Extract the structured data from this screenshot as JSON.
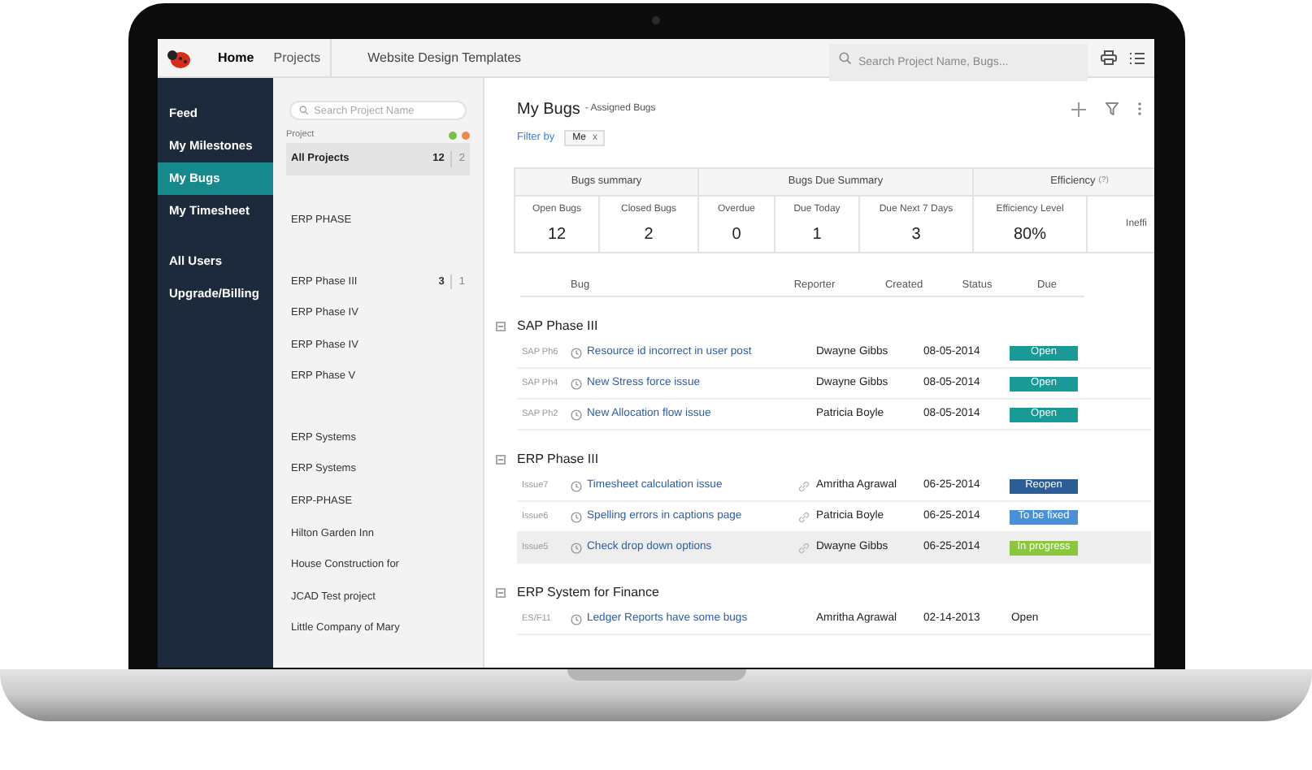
{
  "topbar": {
    "tabs": [
      {
        "label": "Home",
        "selected": true
      },
      {
        "label": "Projects",
        "selected": false
      }
    ],
    "title": "Website Design Templates",
    "search": {
      "placeholder": "Search Project Name, Bugs..."
    }
  },
  "nav": {
    "items": [
      {
        "label": "Feed",
        "selected": false
      },
      {
        "label": "My Milestones",
        "selected": false
      },
      {
        "label": "My Bugs",
        "selected": true
      },
      {
        "label": "My Timesheet",
        "selected": false
      }
    ],
    "secondary": [
      {
        "label": "All Users",
        "selected": false
      },
      {
        "label": "Upgrade/Billing",
        "selected": false
      }
    ]
  },
  "projects": {
    "search": {
      "placeholder": "Search Project Name"
    },
    "header": "Project",
    "legend": [
      {
        "color": "#7ac143"
      },
      {
        "color": "#f08a4b"
      }
    ],
    "all": {
      "label": "All Projects",
      "open": "12",
      "closed": "2",
      "selected": true
    },
    "groups": [
      [
        {
          "label": "ERP PHASE"
        }
      ],
      [
        {
          "label": "ERP Phase III",
          "open": "3",
          "closed": "1"
        },
        {
          "label": "ERP Phase IV"
        },
        {
          "label": "ERP Phase IV"
        },
        {
          "label": "ERP Phase V"
        }
      ],
      [
        {
          "label": "ERP Systems"
        },
        {
          "label": "ERP Systems"
        },
        {
          "label": "ERP-PHASE"
        },
        {
          "label": "Hilton Garden Inn"
        },
        {
          "label": "House Construction for"
        },
        {
          "label": "JCAD Test project"
        },
        {
          "label": "Little Company of Mary"
        }
      ]
    ]
  },
  "main": {
    "title": "My Bugs",
    "subtitle": "- Assigned Bugs",
    "filter": {
      "label": "Filter by",
      "chip": "Me",
      "remove": "x"
    },
    "summary": [
      {
        "title": "Bugs summary",
        "cells": [
          {
            "label": "Open Bugs",
            "value": "12"
          },
          {
            "label": "Closed Bugs",
            "value": "2"
          }
        ]
      },
      {
        "title": "Bugs Due Summary",
        "cells": [
          {
            "label": "Overdue",
            "value": "0"
          },
          {
            "label": "Due Today",
            "value": "1"
          },
          {
            "label": "Due Next 7 Days",
            "value": "3"
          }
        ]
      },
      {
        "title": "Efficiency",
        "hint": "(?)",
        "cells": [
          {
            "label": "Efficiency Level",
            "value": "80%"
          },
          {
            "label": "Ineffi"
          }
        ]
      }
    ],
    "columns": [
      "Bug",
      "Reporter",
      "Created",
      "Status",
      "Due"
    ],
    "groups": [
      {
        "name": "SAP Phase III",
        "expanded": true,
        "rows": [
          {
            "id": "SAP Ph6",
            "title": "Resource id incorrect in user post",
            "linked": false,
            "reporter": "Dwayne Gibbs",
            "created": "08-05-2014",
            "status": "Open",
            "kind": "badge",
            "color": "#1a9a96",
            "selected": false
          },
          {
            "id": "SAP Ph4",
            "title": "New Stress force issue",
            "linked": false,
            "reporter": "Dwayne Gibbs",
            "created": "08-05-2014",
            "status": "Open",
            "kind": "badge",
            "color": "#1a9a96",
            "selected": false
          },
          {
            "id": "SAP Ph2",
            "title": "New Allocation flow issue",
            "linked": false,
            "reporter": "Patricia Boyle",
            "created": "08-05-2014",
            "status": "Open",
            "kind": "badge",
            "color": "#1a9a96",
            "selected": false
          }
        ]
      },
      {
        "name": "ERP Phase III",
        "expanded": true,
        "rows": [
          {
            "id": "Issue7",
            "title": "Timesheet calculation issue",
            "linked": true,
            "reporter": "Amritha Agrawal",
            "created": "06-25-2014",
            "status": "Reopen",
            "kind": "badge",
            "color": "#2c5d96",
            "selected": false
          },
          {
            "id": "Issue6",
            "title": "Spelling errors in captions page",
            "linked": true,
            "reporter": "Patricia Boyle",
            "created": "06-25-2014",
            "status": "To be fixed",
            "kind": "badge",
            "color": "#4a90d9",
            "selected": false
          },
          {
            "id": "Issue5",
            "title": "Check drop down options",
            "linked": true,
            "reporter": "Dwayne Gibbs",
            "created": "06-25-2014",
            "status": "In progress",
            "kind": "badge",
            "color": "#8cc63f",
            "selected": true
          }
        ]
      },
      {
        "name": "ERP System for Finance",
        "expanded": true,
        "rows": [
          {
            "id": "ES/F11",
            "title": "Ledger Reports have some bugs",
            "linked": false,
            "reporter": "Amritha Agrawal",
            "created": "02-14-2013",
            "status": "Open",
            "kind": "plain",
            "color": "#222222",
            "selected": false
          }
        ]
      }
    ]
  }
}
